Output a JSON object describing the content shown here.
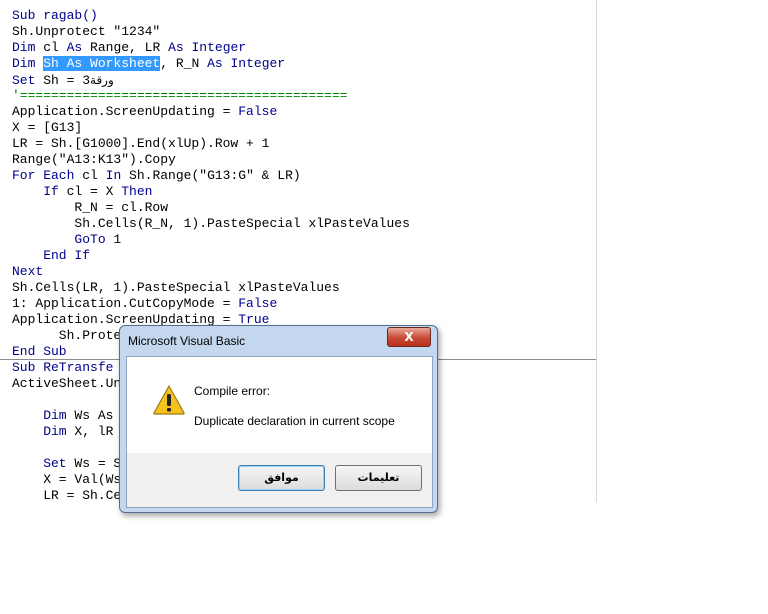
{
  "code_upper": {
    "l1": "Sub ragab()",
    "l2": "Sh.Unprotect \"1234\"",
    "l3a": "Dim",
    "l3b": " cl ",
    "l3c": "As",
    "l3d": " Range, LR ",
    "l3e": "As",
    "l3f": " ",
    "l3g": "Integer",
    "l4a": "Dim",
    "l4b": " ",
    "l4sel": "Sh As Worksheet",
    "l4c": ", R_N ",
    "l4d": "As",
    "l4e": " ",
    "l4f": "Integer",
    "l5a": "Set",
    "l5b": " Sh = 3",
    "l5c": "ورقة",
    "l6": "'==========================================",
    "l7a": "Application.ScreenUpdating = ",
    "l7b": "False",
    "l8": "X = [G13]",
    "l9": "LR = Sh.[G1000].End(xlUp).Row + 1",
    "l10": "Range(\"A13:K13\").Copy",
    "l11a": "For Each",
    "l11b": " cl ",
    "l11c": "In",
    "l11d": " Sh.Range(\"G13:G\" & LR)",
    "l12a": "    If",
    "l12b": " cl = X ",
    "l12c": "Then",
    "l13": "        R_N = cl.Row",
    "l14": "        Sh.Cells(R_N, 1).PasteSpecial xlPasteValues",
    "l15a": "        GoTo",
    "l15b": " 1",
    "l16": "    End If",
    "l17": "Next",
    "l18": "Sh.Cells(LR, 1).PasteSpecial xlPasteValues",
    "l19a": "1: Application.CutCopyMode = ",
    "l19b": "False",
    "l20a": "Application.ScreenUpdating = ",
    "l20b": "True",
    "l21": "      Sh.Prote",
    "l22": "End Sub"
  },
  "code_lower": {
    "l1": "Sub ReTransfe",
    "l2": "ActiveSheet.Un",
    "l3a": "    Dim",
    "l3b": " Ws As",
    "l4a": "    Dim",
    "l4b": " X, lR",
    "l5a": "    Set",
    "l5b": " Ws = S",
    "l6": "    X = Val(Ws",
    "l7": "    LR = Sh.Ce"
  },
  "dialog": {
    "title": "Microsoft Visual Basic",
    "close_glyph": "X",
    "message_title": "Compile error:",
    "message_body": "Duplicate declaration in current scope",
    "ok_label": "موافق",
    "help_label": "تعليمات"
  },
  "colors": {
    "keyword": "#00008b",
    "selection": "#3399ff",
    "comment": "#008000",
    "dialog_frame": "#c3d8ee"
  },
  "icons": {
    "warning": "warning-icon"
  }
}
